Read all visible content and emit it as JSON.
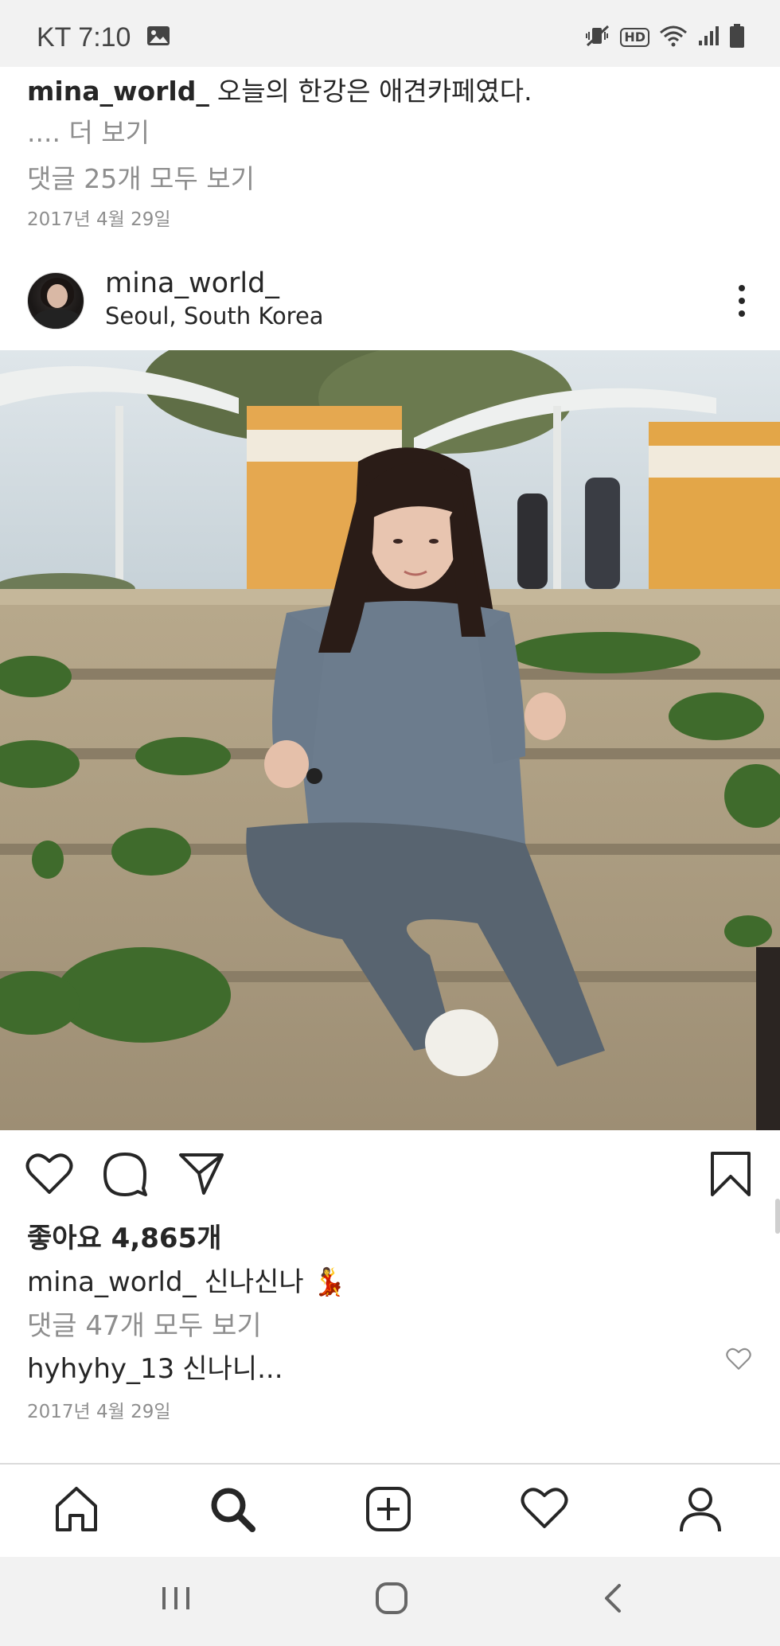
{
  "status_bar": {
    "carrier_time": "KT 7:10",
    "icons": [
      "gallery-icon",
      "mute-vibrate-icon",
      "hd-icon",
      "wifi-icon",
      "signal-icon",
      "battery-icon"
    ],
    "hd_label": "HD"
  },
  "previous_post": {
    "username": "mina_world_",
    "caption": "오늘의 한강은 애견카페였다.",
    "more_label": ".... 더 보기",
    "view_comments": "댓글 25개 모두 보기",
    "date": "2017년 4월 29일"
  },
  "post": {
    "username": "mina_world_",
    "location": "Seoul, South Korea",
    "likes": "좋아요 4,865개",
    "caption_username": "mina_world_",
    "caption_text": "신나신나 💃",
    "view_comments": "댓글 47개 모두 보기",
    "comment_username": "hyhyhy_13",
    "comment_text": "신나니...",
    "date": "2017년 4월 29일"
  },
  "actions": {
    "icons": [
      "heart-icon",
      "comment-icon",
      "share-icon",
      "bookmark-icon"
    ]
  },
  "bottom_nav": {
    "items": [
      "home-icon",
      "search-icon",
      "add-post-icon",
      "activity-heart-icon",
      "profile-icon"
    ],
    "active": "search-icon"
  },
  "system_nav": {
    "items": [
      "recent-apps-icon",
      "home-button-icon",
      "back-icon"
    ]
  },
  "colors": {
    "text": "#262626",
    "secondary_text": "#8e8e8e",
    "divider": "#dbdbdb",
    "system_bar": "#f2f2f2"
  }
}
